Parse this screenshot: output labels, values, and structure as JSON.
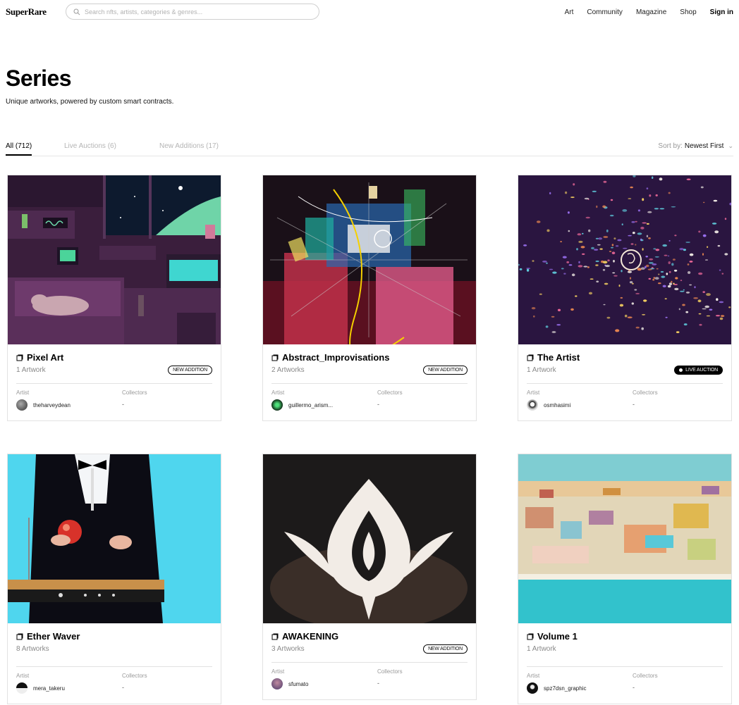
{
  "header": {
    "logo": "SuperRare",
    "search_placeholder": "Search nfts, artists, categories & genres...",
    "nav": [
      "Art",
      "Community",
      "Magazine",
      "Shop",
      "Sign in"
    ]
  },
  "page": {
    "title": "Series",
    "subtitle": "Unique artworks, powered by custom smart contracts."
  },
  "tabs": [
    "All (712)",
    "Live Auctions (6)",
    "New Additions (17)"
  ],
  "sort": {
    "label": "Sort by:",
    "value": "Newest First"
  },
  "labels": {
    "artist": "Artist",
    "collectors": "Collectors"
  },
  "cards": [
    {
      "name": "Pixel Art",
      "count": "1 Artwork",
      "badge": "NEW ADDITION",
      "artist": "theharveydean",
      "collectors": "-"
    },
    {
      "name": "Abstract_Improvisations",
      "count": "2 Artworks",
      "badge": "NEW ADDITION",
      "artist": "guillermo_arism...",
      "collectors": "-"
    },
    {
      "name": "The Artist",
      "count": "1 Artwork",
      "badge": "LIVE AUCTION",
      "artist": "osmhasimi",
      "collectors": "-"
    },
    {
      "name": "Ether Waver",
      "count": "8 Artworks",
      "badge": "",
      "artist": "mera_takeru",
      "collectors": "-"
    },
    {
      "name": "AWAKENING",
      "count": "3 Artworks",
      "badge": "NEW ADDITION",
      "artist": "sfumato",
      "collectors": "-"
    },
    {
      "name": "Volume 1",
      "count": "1 Artwork",
      "badge": "",
      "artist": "spz7dsn_graphic",
      "collectors": "-"
    }
  ],
  "colors": {
    "accent": "#000000",
    "muted": "#999999",
    "border": "#e2e2e2"
  }
}
